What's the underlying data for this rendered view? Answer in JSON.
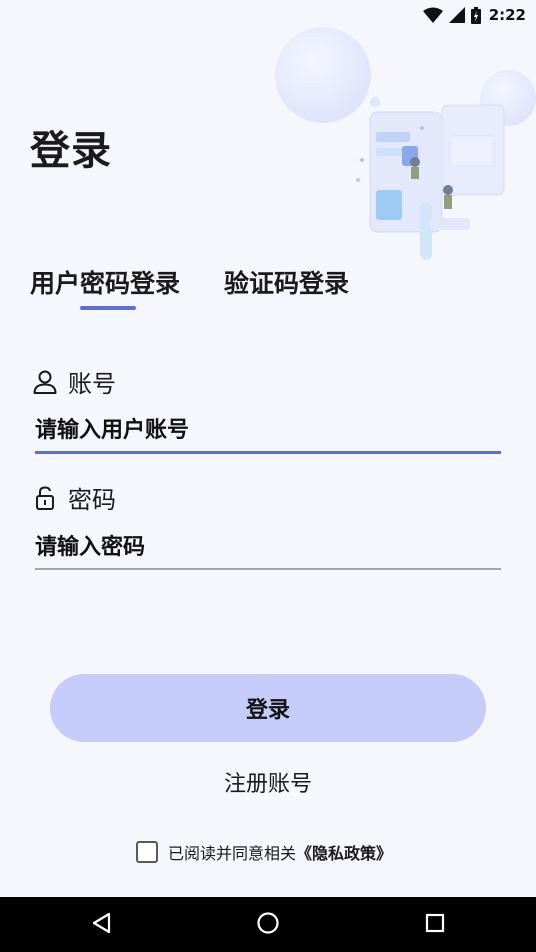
{
  "status": {
    "time": "2:22"
  },
  "title": "登录",
  "tabs": [
    {
      "label": "用户密码登录",
      "active": true
    },
    {
      "label": "验证码登录",
      "active": false
    }
  ],
  "account": {
    "label": "账号",
    "placeholder": "请输入用户账号",
    "value": ""
  },
  "password": {
    "label": "密码",
    "placeholder": "请输入密码",
    "value": ""
  },
  "login_button": "登录",
  "register_link": "注册账号",
  "agreement": {
    "text": "已阅读并同意相关",
    "policy": "《隐私政策》",
    "checked": false
  },
  "colors": {
    "accent": "#5b6ee1",
    "button_bg": "#c6ccf9",
    "background": "#f6f6fd"
  },
  "nav": {
    "back_icon": "back-triangle-icon",
    "home_icon": "home-circle-icon",
    "recents_icon": "recents-square-icon"
  }
}
